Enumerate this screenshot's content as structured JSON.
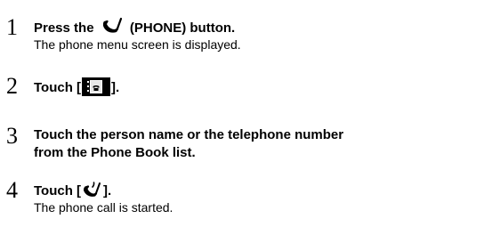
{
  "steps": [
    {
      "number": "1",
      "title_before": "Press the",
      "icon": "handset-icon",
      "title_after": "(PHONE) button.",
      "description": "The phone menu screen is displayed."
    },
    {
      "number": "2",
      "title_before": "Touch [",
      "icon": "phone-book-icon",
      "title_after": "]."
    },
    {
      "number": "3",
      "title_line1": "Touch the person name or the telephone number",
      "title_line2": "from the Phone Book list."
    },
    {
      "number": "4",
      "title_before": "Touch [",
      "icon": "call-icon",
      "title_after": "].",
      "description": "The phone call is started."
    }
  ]
}
